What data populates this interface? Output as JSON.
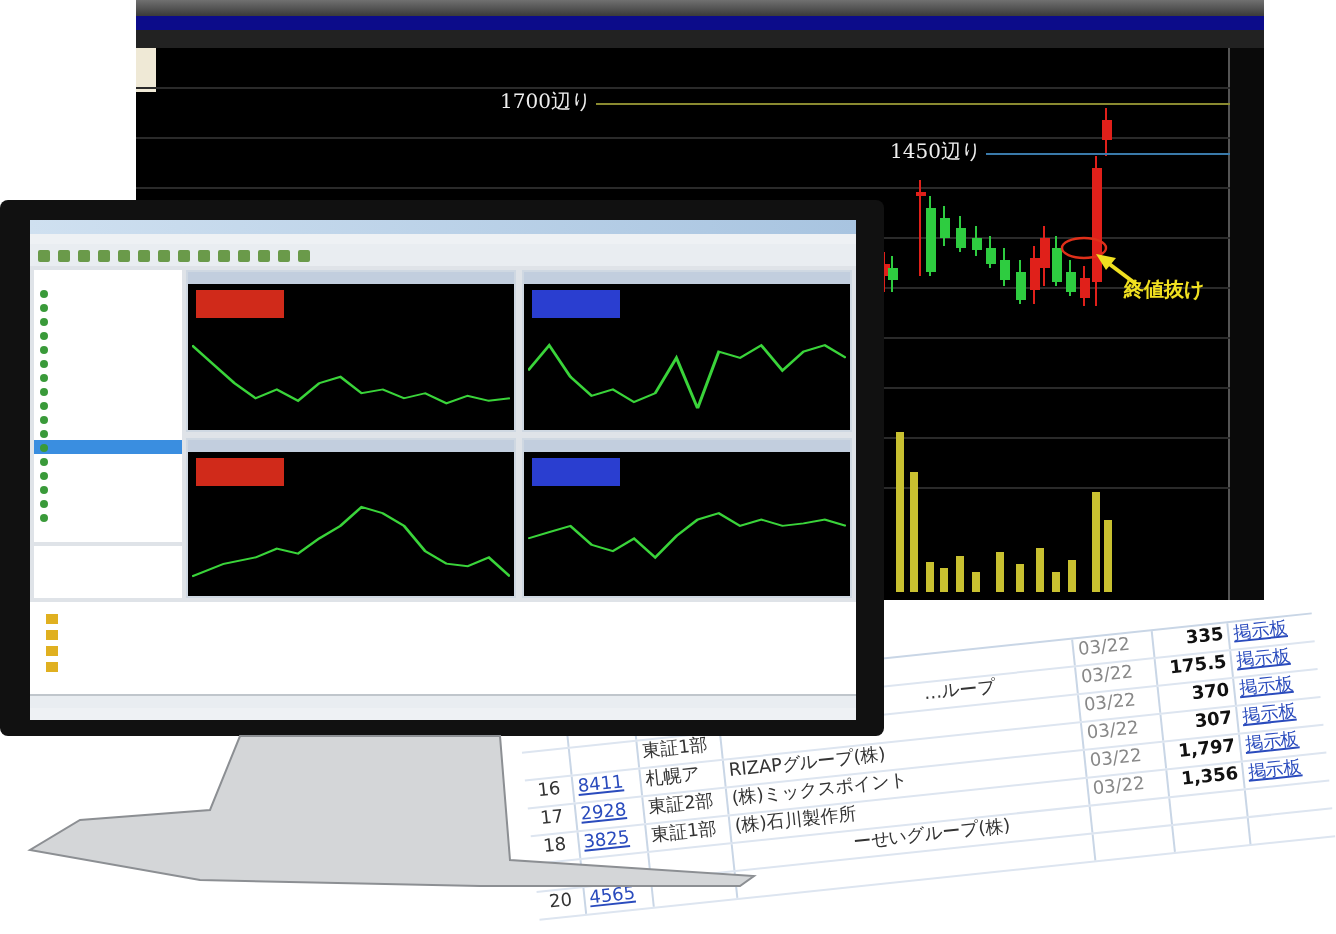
{
  "back_chart": {
    "annotations": [
      {
        "kind": "level",
        "text": "1700辺り"
      },
      {
        "kind": "level",
        "text": "1450辺り"
      },
      {
        "kind": "callout",
        "text": "終値抜け"
      }
    ]
  },
  "ranking_table": {
    "rows": [
      {
        "date": "03/22",
        "price": "335",
        "link": "掲示板"
      },
      {
        "name": "…ループ",
        "date": "03/22",
        "price": "175.5",
        "link": "掲示板"
      },
      {
        "market": "東証1部",
        "date": "03/22",
        "price": "370",
        "link": "掲示板"
      },
      {
        "rank": "16",
        "code": "8411",
        "market": "札幌ア",
        "name": "RIZAPグループ(株)",
        "date": "03/22",
        "price": "307",
        "link": "掲示板"
      },
      {
        "rank": "17",
        "code": "2928",
        "market": "東証2部",
        "name": "(株)ミックスポイント",
        "date": "03/22",
        "price": "1,797",
        "link": "掲示板"
      },
      {
        "rank": "18",
        "code": "3825",
        "market": "東証1部",
        "name": "(株)石川製作所",
        "date": "03/22",
        "price": "1,356",
        "link": "掲示板"
      },
      {
        "name": "ーせいグループ(株)"
      },
      {
        "rank": "20",
        "code": "4565"
      }
    ]
  }
}
